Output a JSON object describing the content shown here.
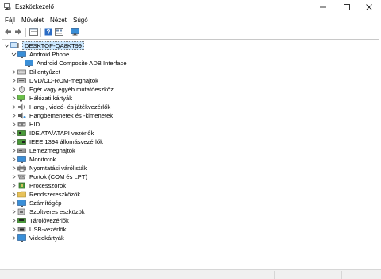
{
  "window": {
    "title": "Eszközkezelő"
  },
  "menu": [
    {
      "label": "Fájl",
      "name": "menu-file"
    },
    {
      "label": "Művelet",
      "name": "menu-action"
    },
    {
      "label": "Nézet",
      "name": "menu-view"
    },
    {
      "label": "Súgó",
      "name": "menu-help"
    }
  ],
  "toolbar": {
    "buttons": [
      "back-arrow-icon",
      "forward-arrow-icon",
      "properties-icon",
      "help-icon",
      "details-icon",
      "monitor-icon"
    ]
  },
  "tree": {
    "root": {
      "label": "DESKTOP-QA8KT99",
      "icon": "computer-icon"
    },
    "items": [
      {
        "label": "Android Phone",
        "icon": "phone-icon",
        "expanded": true,
        "children": [
          {
            "label": "Android Composite ADB Interface",
            "icon": "usb-device-icon"
          }
        ]
      },
      {
        "label": "Billentyűzet",
        "icon": "keyboard-icon"
      },
      {
        "label": "DVD/CD-ROM-meghajtók",
        "icon": "disc-drive-icon"
      },
      {
        "label": "Egér vagy egyéb mutatóeszköz",
        "icon": "mouse-icon"
      },
      {
        "label": "Hálózati kártyák",
        "icon": "network-adapter-icon"
      },
      {
        "label": "Hang-, videó- és játékvezérlők",
        "icon": "speaker-icon"
      },
      {
        "label": "Hangbemenetek és -kimenetek",
        "icon": "audio-io-icon"
      },
      {
        "label": "HID",
        "icon": "hid-icon"
      },
      {
        "label": "IDE ATA/ATAPI vezérlők",
        "icon": "ide-controller-icon"
      },
      {
        "label": "IEEE 1394 állomásvezérlők",
        "icon": "firewire-icon"
      },
      {
        "label": "Lemezmeghajtók",
        "icon": "disk-drive-icon"
      },
      {
        "label": "Monitorok",
        "icon": "monitor-icon"
      },
      {
        "label": "Nyomtatási várólisták",
        "icon": "printer-icon"
      },
      {
        "label": "Portok (COM és LPT)",
        "icon": "port-icon"
      },
      {
        "label": "Processzorok",
        "icon": "processor-icon"
      },
      {
        "label": "Rendszereszközök",
        "icon": "system-device-icon"
      },
      {
        "label": "Számítógép",
        "icon": "computer-icon"
      },
      {
        "label": "Szoftveres eszközök",
        "icon": "software-device-icon"
      },
      {
        "label": "Tárolóvezérlők",
        "icon": "storage-controller-icon"
      },
      {
        "label": "USB-vezérlők",
        "icon": "usb-controller-icon"
      },
      {
        "label": "Videokártyák",
        "icon": "display-adapter-icon"
      }
    ]
  },
  "colors": {
    "selection": "#cce8ff",
    "border": "#c8c8c8",
    "folder": "#e8c25a",
    "monitor_blue": "#3a8fd8"
  }
}
